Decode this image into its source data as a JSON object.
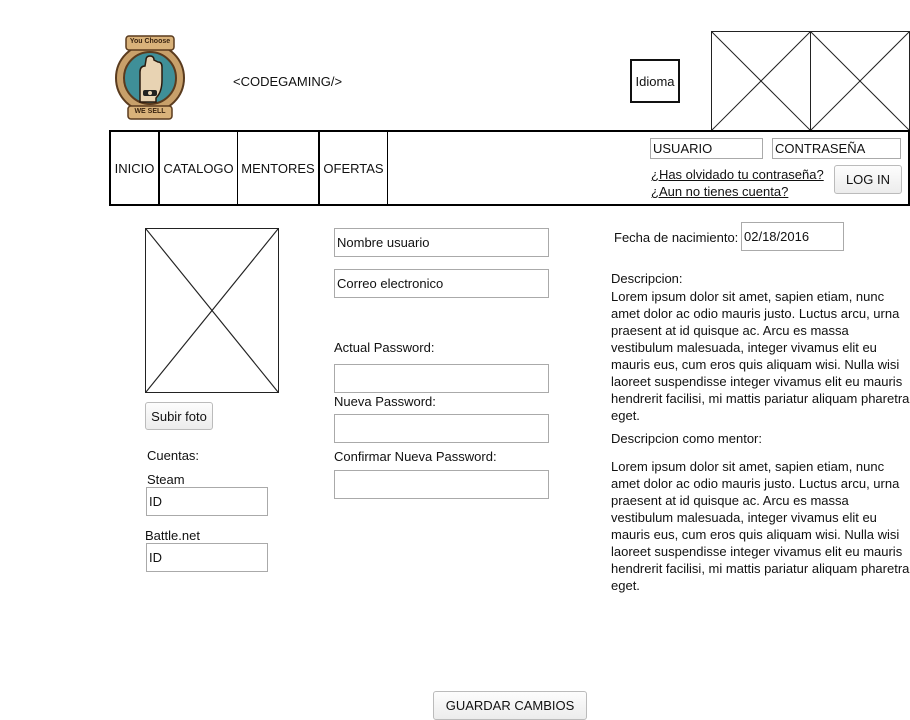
{
  "header": {
    "logo_top_text": "You Choose",
    "logo_bottom_text": "WE SELL",
    "site_name": "<CODEGAMING/>",
    "language_button": "Idioma"
  },
  "nav": {
    "items": [
      {
        "label": "INICIO"
      },
      {
        "label": "CATALOGO"
      },
      {
        "label": "MENTORES"
      },
      {
        "label": "OFERTAS"
      }
    ]
  },
  "login": {
    "username_value": "USUARIO",
    "password_value": "CONTRASEÑA",
    "forgot_link": "¿Has olvidado tu contraseña?",
    "register_link": "¿Aun no tienes cuenta?",
    "login_button": "LOG IN"
  },
  "profile": {
    "upload_button": "Subir foto",
    "accounts_label": "Cuentas:",
    "steam_label": "Steam",
    "steam_value": "ID",
    "battlenet_label": "Battle.net",
    "battlenet_value": "ID"
  },
  "form": {
    "username_value": "Nombre usuario",
    "email_value": "Correo electronico",
    "current_password_label": "Actual Password:",
    "new_password_label": "Nueva Password:",
    "confirm_password_label": "Confirmar Nueva Password:"
  },
  "details": {
    "birthdate_label": "Fecha de nacimiento:",
    "birthdate_value": "02/18/2016",
    "description_label": "Descripcion:",
    "description_text": "Lorem ipsum dolor sit amet, sapien etiam, nunc amet dolor ac odio mauris justo. Luctus arcu, urna praesent at id quisque ac. Arcu es massa vestibulum malesuada, integer vivamus elit eu mauris eus, cum eros quis aliquam wisi. Nulla wisi laoreet suspendisse integer vivamus elit eu mauris hendrerit facilisi, mi mattis pariatur aliquam pharetra eget.",
    "mentor_label": "Descripcion como mentor:",
    "mentor_text": "Lorem ipsum dolor sit amet, sapien etiam, nunc amet dolor ac odio mauris justo. Luctus arcu, urna praesent at id quisque ac. Arcu es massa vestibulum malesuada, integer vivamus elit eu mauris eus, cum eros quis aliquam wisi. Nulla wisi laoreet suspendisse integer vivamus elit eu mauris hendrerit facilisi, mi mattis pariatur aliquam pharetra eget."
  },
  "footer": {
    "save_button": "GUARDAR CAMBIOS"
  }
}
